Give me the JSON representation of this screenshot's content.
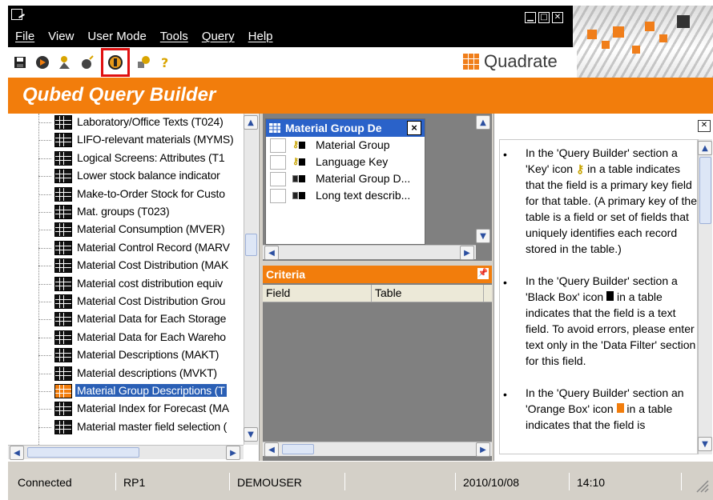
{
  "menu": [
    "File",
    "View",
    "User Mode",
    "Tools",
    "Query",
    "Help"
  ],
  "window_controls": [
    "minimize",
    "maximize",
    "close"
  ],
  "toolbar_icons": [
    "save-icon",
    "forward-icon",
    "user-icon",
    "bomb-icon",
    "execute-icon",
    "refresh-icon",
    "help-icon"
  ],
  "logo_text": "Quadrate",
  "banner_title": "Qubed Query Builder",
  "tree_items": [
    "Laboratory/Office Texts (T024)",
    "LIFO-relevant materials (MYMS)",
    "Logical Screens: Attributes (T1",
    "Lower stock balance indicator",
    "Make-to-Order Stock for Custo",
    "Mat. groups (T023)",
    "Material Consumption (MVER)",
    "Material Control Record (MARV",
    "Material Cost Distribution (MAK",
    "Material cost distribution equiv",
    "Material Cost Distribution Grou",
    "Material Data for Each Storage",
    "Material Data for Each Wareho",
    "Material Descriptions (MAKT)",
    "Material descriptions (MVKT)",
    "Material Group Descriptions (T",
    "Material Index for Forecast (MA",
    "Material master field selection ("
  ],
  "selected_tree_index": 15,
  "field_box": {
    "title": "Material Group De",
    "fields": [
      {
        "icon": "key",
        "label": "Material Group"
      },
      {
        "icon": "key",
        "label": "Language Key"
      },
      {
        "icon": "graybox",
        "label": "Material Group D..."
      },
      {
        "icon": "graybox",
        "label": "Long text describ..."
      }
    ]
  },
  "criteria": {
    "title": "Criteria",
    "columns": [
      "Field",
      "Table"
    ]
  },
  "help": [
    {
      "pre": "In the 'Query Builder' section a 'Key' icon",
      "icon": "key",
      "post": "in a table indicates that the field is a primary key field for that table. (A primary key of the table is a field or set of fields that uniquely identifies each record stored in the table.)"
    },
    {
      "pre": "In the 'Query Builder' section a 'Black Box' icon",
      "icon": "black",
      "post": "in a table indicates that the field is a text field. To avoid errors, please enter text only in the 'Data Filter' section for this field."
    },
    {
      "pre": "In the 'Query Builder' section an 'Orange Box' icon",
      "icon": "orange",
      "post": "in a table indicates that the field is"
    }
  ],
  "status": {
    "connection": "Connected",
    "system": "RP1",
    "user": "DEMOUSER",
    "date": "2010/10/08",
    "time": "14:10"
  },
  "colors": {
    "accent": "#f27d0c",
    "title_blue": "#2a62c9",
    "selection": "#2a5fb5"
  }
}
